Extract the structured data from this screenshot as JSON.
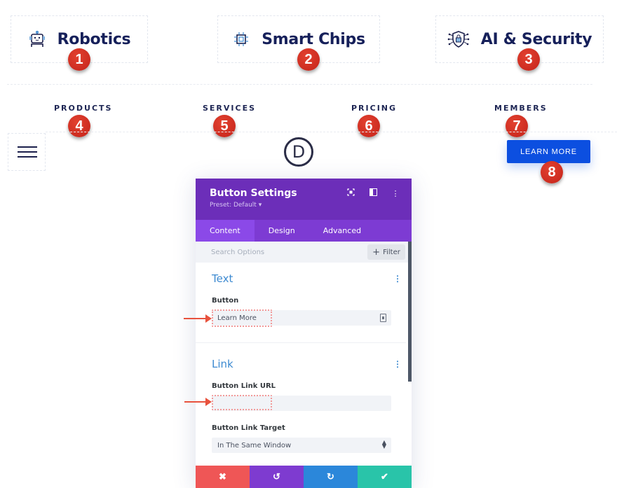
{
  "header_cards": [
    {
      "title": "Robotics",
      "icon": "robot-icon",
      "badge": "1"
    },
    {
      "title": "Smart Chips",
      "icon": "chip-icon",
      "badge": "2"
    },
    {
      "title": "AI & Security",
      "icon": "shield-lock-icon",
      "badge": "3"
    }
  ],
  "nav": [
    {
      "label": "PRODUCTS",
      "badge": "4"
    },
    {
      "label": "SERVICES",
      "badge": "5"
    },
    {
      "label": "PRICING",
      "badge": "6"
    },
    {
      "label": "MEMBERS",
      "badge": "7"
    }
  ],
  "logo_letter": "D",
  "cta": {
    "label": "LEARN MORE",
    "badge": "8"
  },
  "panel": {
    "title": "Button Settings",
    "preset": "Preset: Default ▾",
    "header_icons": [
      "expand-icon",
      "sidebar-layout-icon",
      "more-vertical-icon"
    ],
    "tabs": [
      {
        "label": "Content",
        "active": true
      },
      {
        "label": "Design",
        "active": false
      },
      {
        "label": "Advanced",
        "active": false
      }
    ],
    "search_placeholder": "Search Options",
    "filter_label": "Filter",
    "sections": {
      "text": {
        "title": "Text",
        "button_label": "Button",
        "button_value": "Learn More"
      },
      "link": {
        "title": "Link",
        "url_label": "Button Link URL",
        "url_value": "",
        "target_label": "Button Link Target",
        "target_value": "In The Same Window"
      }
    },
    "actions": [
      "cancel",
      "undo",
      "redo",
      "save"
    ]
  },
  "colors": {
    "brand_navy": "#16205a",
    "cta_blue": "#0c4fe0",
    "panel_purple": "#6c2eb9",
    "tab_purple": "#7d3bd3",
    "section_blue": "#3d8ad1",
    "badge_red": "#d32f24",
    "cancel_red": "#ef5656",
    "redo_blue": "#2b87da",
    "save_green": "#29c4a9"
  }
}
